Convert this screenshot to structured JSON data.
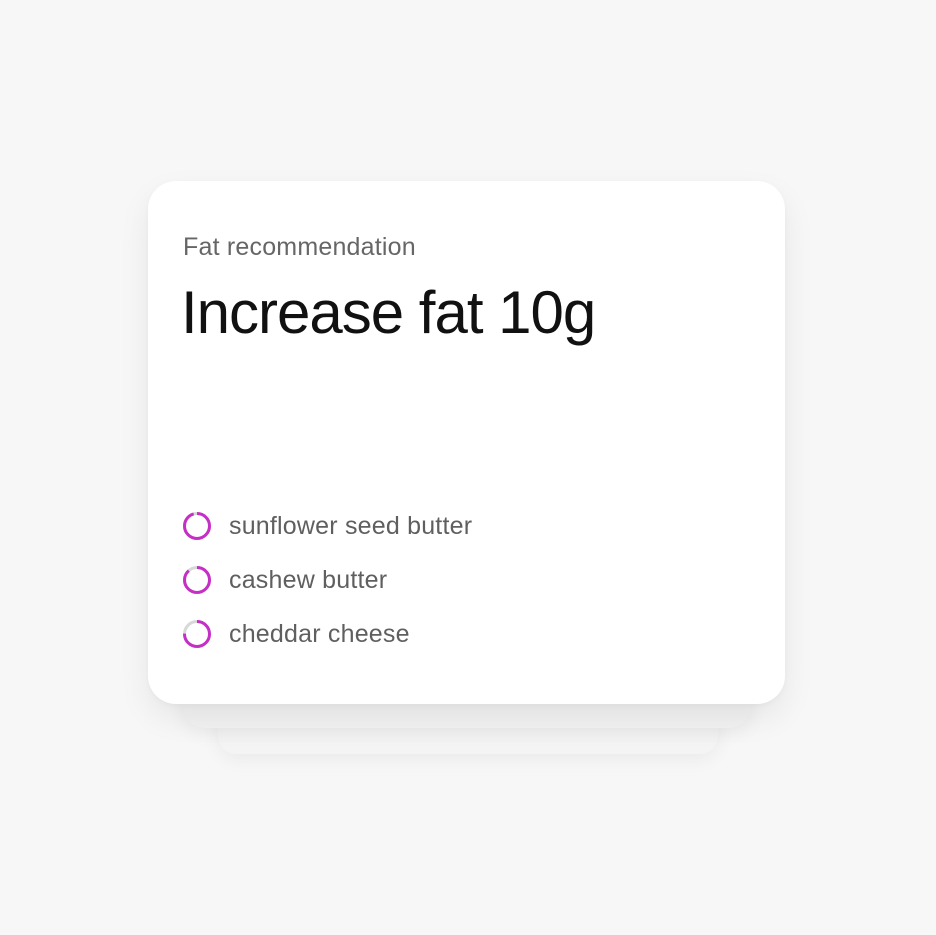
{
  "card": {
    "label": "Fat recommendation",
    "title": "Increase fat 10g"
  },
  "foods": [
    {
      "name": "sunflower seed butter",
      "icon": "progress-ring-icon",
      "fill": 0.95
    },
    {
      "name": "cashew butter",
      "icon": "progress-ring-icon",
      "fill": 0.88
    },
    {
      "name": "cheddar cheese",
      "icon": "progress-ring-icon",
      "fill": 0.75
    }
  ],
  "colors": {
    "accent": "#c62fc6",
    "track": "#d8d8d8",
    "background": "#f7f7f7",
    "card": "#ffffff"
  }
}
